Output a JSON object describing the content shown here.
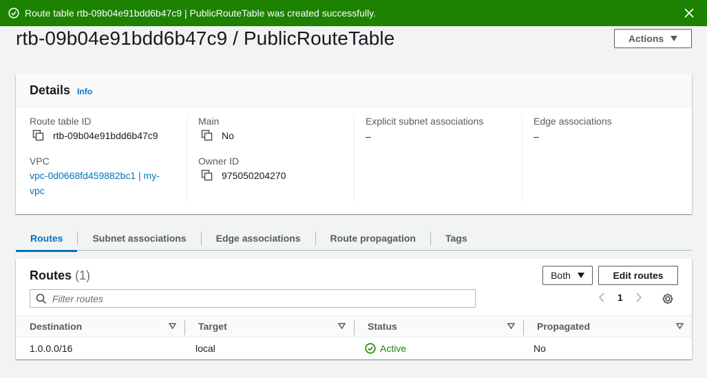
{
  "flash": {
    "message": "Route table rtb-09b04e91bdd6b47c9 | PublicRouteTable was created successfully.",
    "color": "#1d8102"
  },
  "header": {
    "title": "rtb-09b04e91bdd6b47c9 / PublicRouteTable",
    "actions_label": "Actions"
  },
  "details": {
    "title": "Details",
    "info": "Info",
    "route_table_id_label": "Route table ID",
    "route_table_id": "rtb-09b04e91bdd6b47c9",
    "vpc_label": "VPC",
    "vpc_line1": "vpc-0d0668fd459882bc1 | my-",
    "vpc_line2": "vpc",
    "main_label": "Main",
    "main_value": "No",
    "owner_id_label": "Owner ID",
    "owner_id": "975050204270",
    "explicit_label": "Explicit subnet associations",
    "explicit_value": "–",
    "edge_label": "Edge associations",
    "edge_value": "–"
  },
  "tabs": [
    {
      "label": "Routes",
      "active": true
    },
    {
      "label": "Subnet associations",
      "active": false
    },
    {
      "label": "Edge associations",
      "active": false
    },
    {
      "label": "Route propagation",
      "active": false
    },
    {
      "label": "Tags",
      "active": false
    }
  ],
  "routes": {
    "title": "Routes",
    "count": "(1)",
    "select_value": "Both",
    "edit_label": "Edit routes",
    "filter_placeholder": "Filter routes",
    "page": "1",
    "columns": [
      "Destination",
      "Target",
      "Status",
      "Propagated"
    ],
    "rows": [
      {
        "destination": "1.0.0.0/16",
        "target": "local",
        "status": "Active",
        "propagated": "No"
      }
    ]
  },
  "colors": {
    "link": "#0073bb",
    "success": "#1d8102"
  }
}
